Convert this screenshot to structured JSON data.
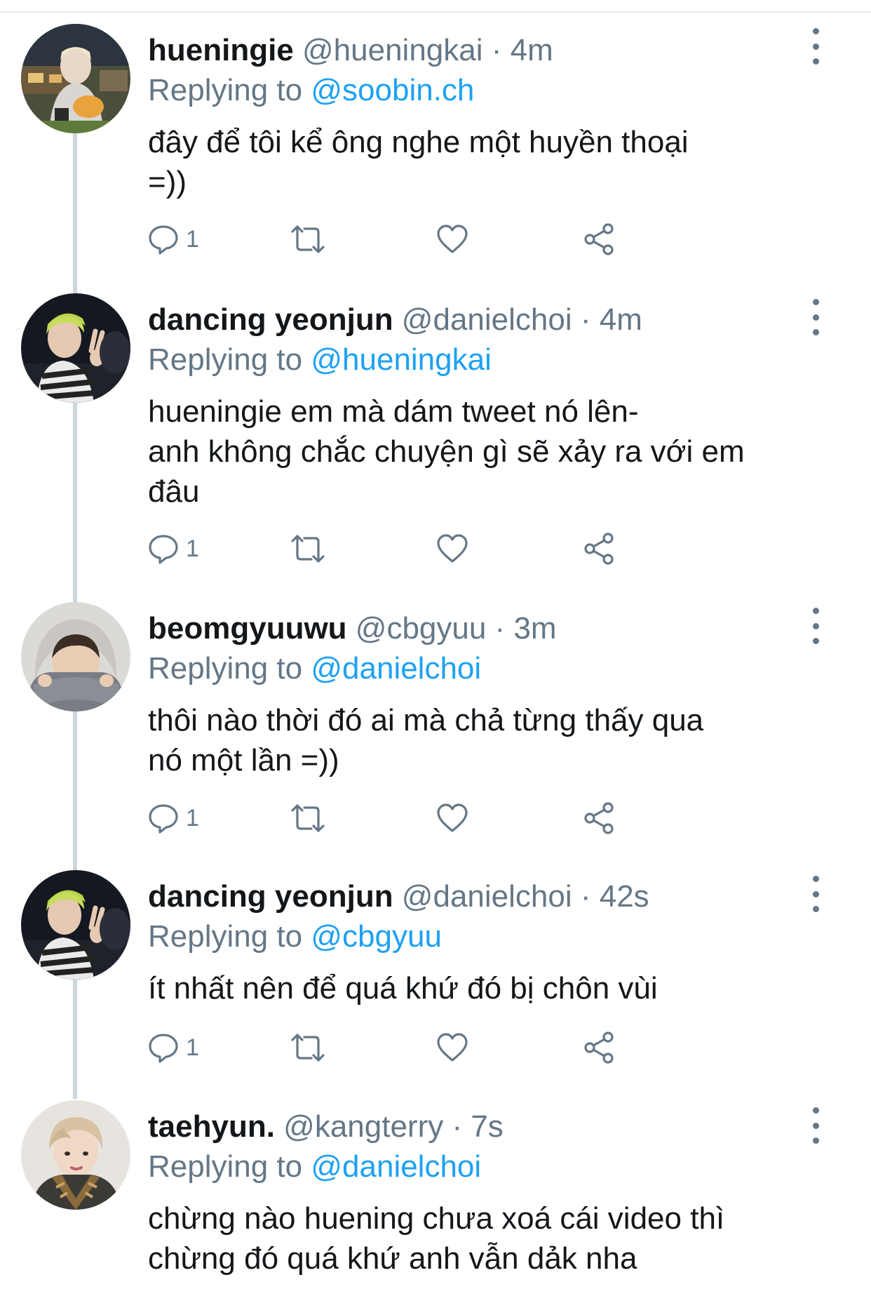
{
  "theme": {
    "text_color": "#14171a",
    "muted_color": "#657786",
    "link_color": "#1da1f2",
    "line_color": "#ccd6dd"
  },
  "tweets": [
    {
      "display_name": "hueningie",
      "meta": " @hueningkai · 4m",
      "replying_label": "Replying to ",
      "replying_handle": "@soobin.ch",
      "text": "đây để tôi kể ông nghe một huyền thoại\n=))",
      "reply_count": "1",
      "avatar_icon": "avatar-photo"
    },
    {
      "display_name": "dancing yeonjun",
      "meta": " @danielchoi · 4m",
      "replying_label": "Replying to ",
      "replying_handle": "@hueningkai",
      "text": "hueningie em mà dám tweet nó lên-\nanh không chắc chuyện gì sẽ xảy ra với em\nđâu",
      "reply_count": "1",
      "avatar_icon": "avatar-photo"
    },
    {
      "display_name": "beomgyuuwu",
      "meta": " @cbgyuu · 3m",
      "replying_label": "Replying to ",
      "replying_handle": "@danielchoi",
      "text": "thôi nào thời đó ai mà chả từng thấy qua\nnó một lần =))",
      "reply_count": "1",
      "avatar_icon": "avatar-photo"
    },
    {
      "display_name": "dancing yeonjun",
      "meta": " @danielchoi · 42s",
      "replying_label": "Replying to ",
      "replying_handle": "@cbgyuu",
      "text": "ít nhất nên để quá khứ đó bị chôn vùi",
      "reply_count": "1",
      "avatar_icon": "avatar-photo"
    },
    {
      "display_name": "taehyun.",
      "meta": " @kangterry · 7s",
      "replying_label": "Replying to ",
      "replying_handle": "@danielchoi",
      "text": "chừng nào huening chưa xoá cái video thì\nchừng đó quá khứ anh vẫn dảk nha",
      "avatar_icon": "avatar-photo"
    }
  ]
}
